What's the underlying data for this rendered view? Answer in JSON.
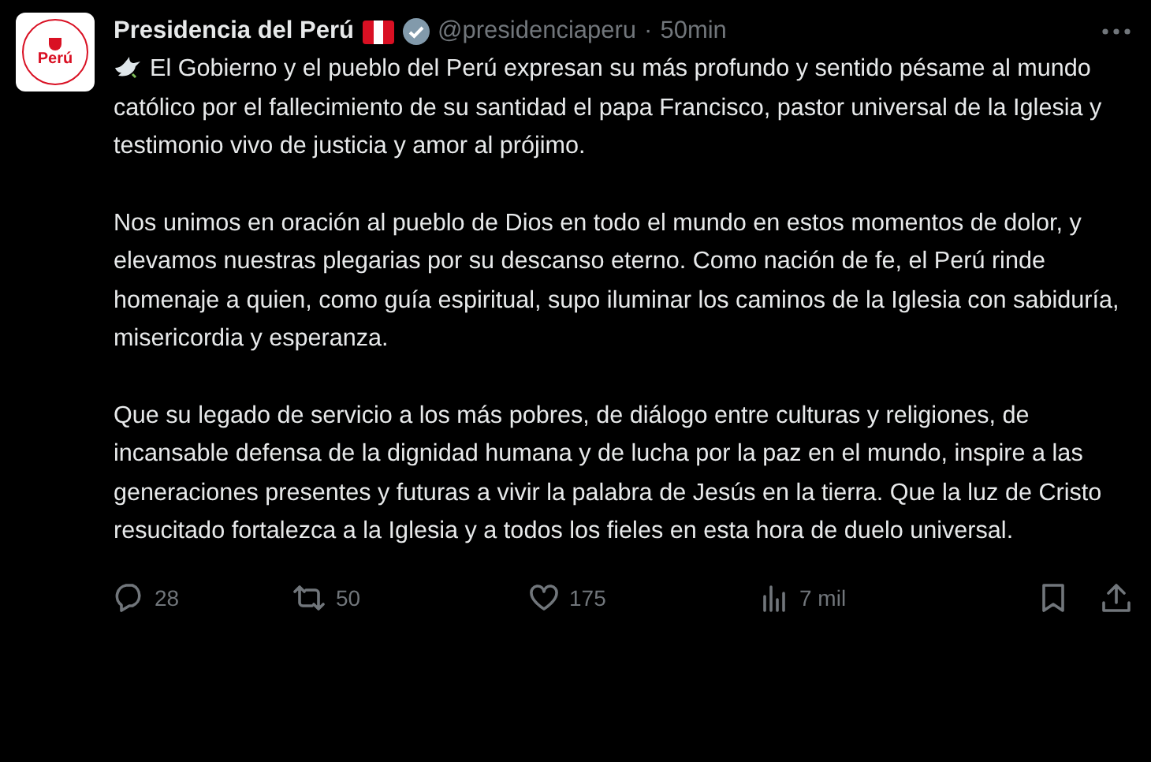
{
  "author": {
    "name": "Presidencia del Perú",
    "handle": "@presidenciaperu",
    "separator": "·",
    "time": "50min",
    "avatar_text": "Perú",
    "verified": true
  },
  "paragraphs": [
    "El Gobierno y el pueblo del Perú expresan su más profundo y sentido pésame al mundo católico por el fallecimiento de su santidad el papa Francisco, pastor universal de la Iglesia y testimonio vivo de justicia y amor al prójimo.",
    "Nos unimos en oración al pueblo de Dios en todo el mundo en estos momentos de dolor, y elevamos nuestras plegarias por su descanso eterno. Como nación de fe, el Perú rinde homenaje a quien, como guía espiritual, supo iluminar los caminos de la Iglesia con sabiduría, misericordia y esperanza.",
    "Que su legado de servicio a los más pobres, de diálogo entre culturas y religiones, de incansable defensa de la dignidad humana y de lucha por la paz en el mundo, inspire a las generaciones presentes y futuras a vivir la palabra de Jesús en la tierra. Que la luz de Cristo resucitado fortalezca a la Iglesia y a todos los fieles en esta hora de duelo universal."
  ],
  "actions": [
    {
      "kind": "reply",
      "count": "28"
    },
    {
      "kind": "repost",
      "count": "50"
    },
    {
      "kind": "like",
      "count": "175"
    },
    {
      "kind": "views",
      "count": "7 mil"
    }
  ]
}
